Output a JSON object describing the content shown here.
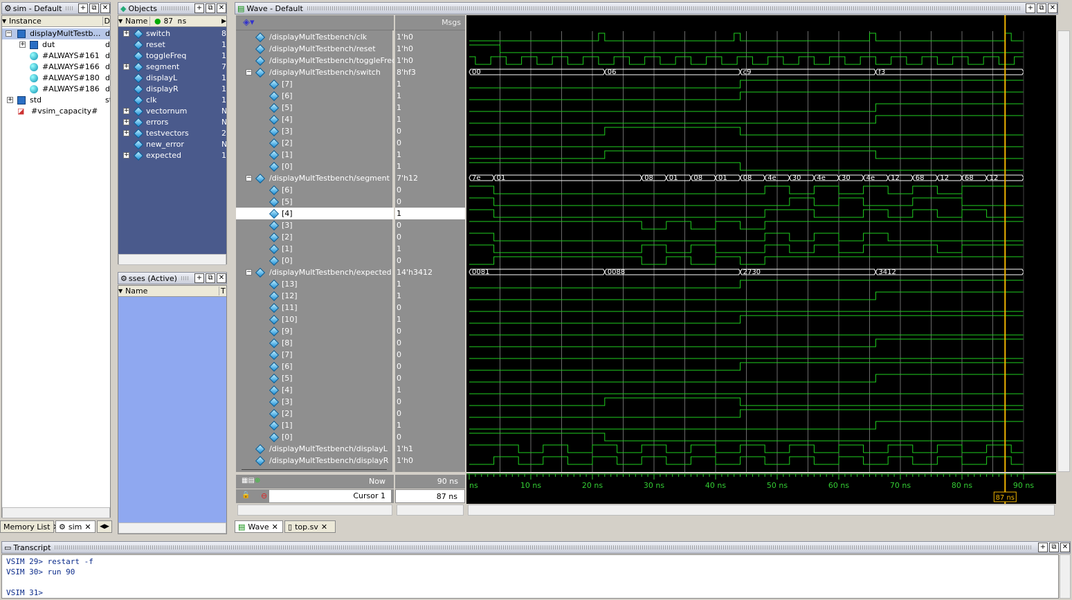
{
  "sim": {
    "title": "sim - Default",
    "col_instance": "Instance",
    "col_design": "D",
    "rows": [
      {
        "label": "displayMultTestbench",
        "d": "di"
      },
      {
        "label": "dut",
        "d": "di"
      },
      {
        "label": "#ALWAYS#161",
        "d": "di"
      },
      {
        "label": "#ALWAYS#166",
        "d": "di"
      },
      {
        "label": "#ALWAYS#180",
        "d": "di"
      },
      {
        "label": "#ALWAYS#186",
        "d": "di"
      },
      {
        "label": "std",
        "d": "st"
      },
      {
        "label": "#vsim_capacity#",
        "d": ""
      }
    ]
  },
  "objects": {
    "title": "Objects",
    "time": "87 ns",
    "col_name": "Name",
    "rows": [
      {
        "label": "switch",
        "v": "8'"
      },
      {
        "label": "reset",
        "v": "1'"
      },
      {
        "label": "toggleFreq",
        "v": "1'"
      },
      {
        "label": "segment",
        "v": "7'"
      },
      {
        "label": "displayL",
        "v": "1'"
      },
      {
        "label": "displayR",
        "v": "1'"
      },
      {
        "label": "clk",
        "v": "1'"
      },
      {
        "label": "vectornum",
        "v": "N"
      },
      {
        "label": "errors",
        "v": "N"
      },
      {
        "label": "testvectors",
        "v": "2"
      },
      {
        "label": "new_error",
        "v": "N"
      },
      {
        "label": "expected",
        "v": "1"
      }
    ]
  },
  "processes": {
    "title": "sses (Active)",
    "col_name": "Name",
    "col_t": "T"
  },
  "wave": {
    "title": "Wave - Default",
    "msgs_header": "Msgs",
    "now_label": "Now",
    "now_value": "90 ns",
    "cursor_label": "Cursor 1",
    "cursor_value": "87 ns",
    "cursor_flag": "87 ns",
    "time_ticks": [
      "ns",
      "10 ns",
      "20 ns",
      "30 ns",
      "40 ns",
      "50 ns",
      "60 ns",
      "70 ns",
      "80 ns",
      "90 ns"
    ],
    "signals": [
      {
        "name": "/displayMultTestbench/clk",
        "value": "1'h0"
      },
      {
        "name": "/displayMultTestbench/reset",
        "value": "1'h0"
      },
      {
        "name": "/displayMultTestbench/toggleFreq",
        "value": "1'h0"
      },
      {
        "name": "/displayMultTestbench/switch",
        "value": "8'hf3"
      },
      {
        "name": "[7]",
        "value": "1"
      },
      {
        "name": "[6]",
        "value": "1"
      },
      {
        "name": "[5]",
        "value": "1"
      },
      {
        "name": "[4]",
        "value": "1"
      },
      {
        "name": "[3]",
        "value": "0"
      },
      {
        "name": "[2]",
        "value": "0"
      },
      {
        "name": "[1]",
        "value": "1"
      },
      {
        "name": "[0]",
        "value": "1"
      },
      {
        "name": "/displayMultTestbench/segment",
        "value": "7'h12"
      },
      {
        "name": "[6]",
        "value": "0"
      },
      {
        "name": "[5]",
        "value": "0"
      },
      {
        "name": "[4]",
        "value": "1"
      },
      {
        "name": "[3]",
        "value": "0"
      },
      {
        "name": "[2]",
        "value": "0"
      },
      {
        "name": "[1]",
        "value": "1"
      },
      {
        "name": "[0]",
        "value": "0"
      },
      {
        "name": "/displayMultTestbench/expected",
        "value": "14'h3412"
      },
      {
        "name": "[13]",
        "value": "1"
      },
      {
        "name": "[12]",
        "value": "1"
      },
      {
        "name": "[11]",
        "value": "0"
      },
      {
        "name": "[10]",
        "value": "1"
      },
      {
        "name": "[9]",
        "value": "0"
      },
      {
        "name": "[8]",
        "value": "0"
      },
      {
        "name": "[7]",
        "value": "0"
      },
      {
        "name": "[6]",
        "value": "0"
      },
      {
        "name": "[5]",
        "value": "0"
      },
      {
        "name": "[4]",
        "value": "1"
      },
      {
        "name": "[3]",
        "value": "0"
      },
      {
        "name": "[2]",
        "value": "0"
      },
      {
        "name": "[1]",
        "value": "1"
      },
      {
        "name": "[0]",
        "value": "0"
      },
      {
        "name": "/displayMultTestbench/displayL",
        "value": "1'h1"
      },
      {
        "name": "/displayMultTestbench/displayR",
        "value": "1'h0"
      }
    ],
    "bus_switch": [
      "00",
      "06",
      "c9",
      "f3"
    ],
    "bus_segment": [
      "7e",
      "01",
      "08",
      "01",
      "08",
      "01",
      "08",
      "4e",
      "30",
      "4e",
      "30",
      "4e",
      "12",
      "68",
      "12",
      "68",
      "12"
    ],
    "bus_expected": [
      "0081",
      "0088",
      "2730",
      "3412"
    ],
    "colors": {
      "wave": "#1fd11f",
      "cursor": "#f0b400",
      "grid": "#6b6b6b",
      "bg": "#000000"
    }
  },
  "tabs_left": [
    {
      "label": "Memory List"
    },
    {
      "label": "sim"
    }
  ],
  "tabs_wave": [
    {
      "label": "Wave"
    },
    {
      "label": "top.sv"
    }
  ],
  "transcript": {
    "title": "Transcript",
    "lines": [
      "VSIM 29> restart -f",
      "VSIM 30> run 90",
      "",
      "VSIM 31>"
    ]
  }
}
